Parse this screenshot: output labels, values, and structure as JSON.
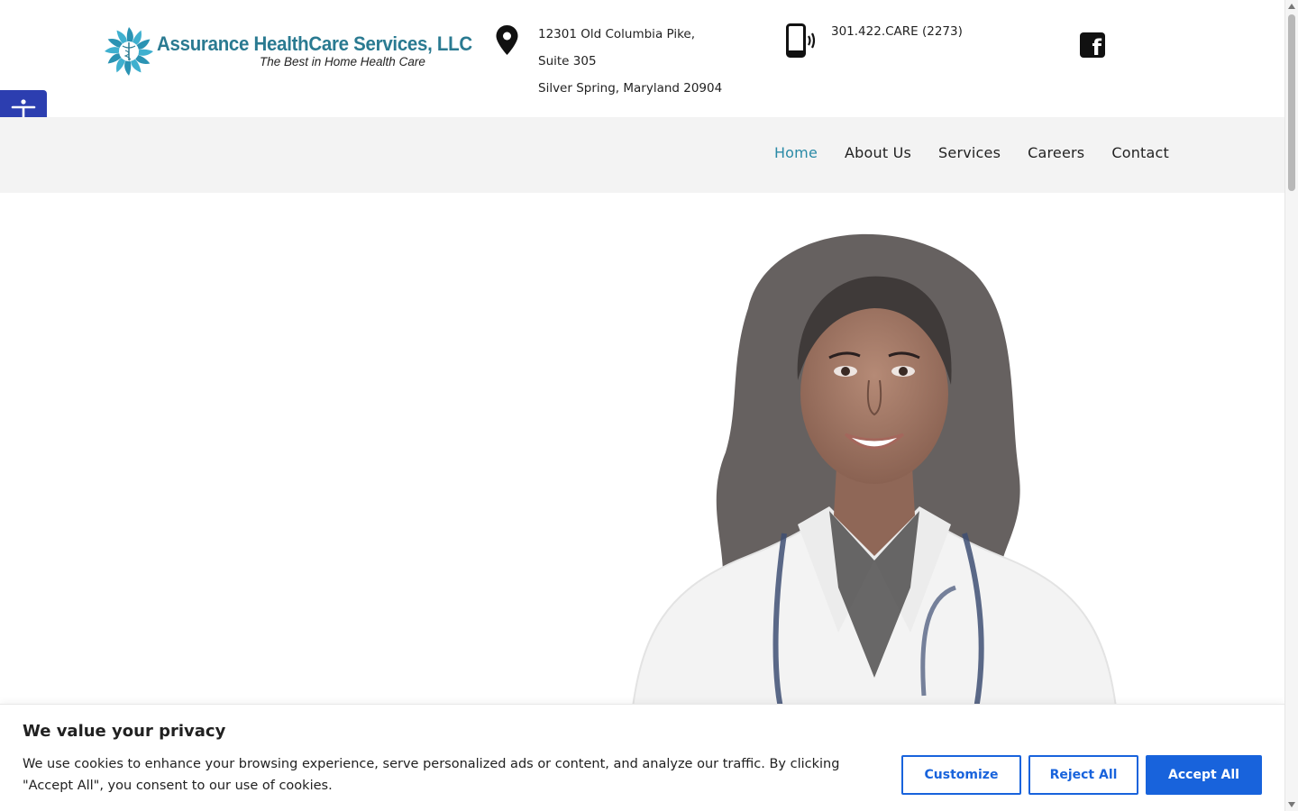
{
  "header": {
    "logo": {
      "name": "Assurance HealthCare Services, LLC",
      "tagline": "The Best in Home Health Care",
      "brand_color": "#2a7a91"
    },
    "address": {
      "icon": "map-marker-icon",
      "line1": "12301 Old Columbia Pike,",
      "line2": "Suite 305",
      "line3": "Silver Spring, Maryland 20904"
    },
    "phone": {
      "icon": "mobile-phone-icon",
      "number": "301.422.CARE (2273)"
    },
    "social": {
      "icon": "facebook-icon"
    },
    "accessibility": {
      "icon": "accessibility-icon",
      "color": "#2c3eb0"
    }
  },
  "nav": {
    "items": [
      {
        "label": "Home",
        "active": true
      },
      {
        "label": "About Us",
        "active": false
      },
      {
        "label": "Services",
        "active": false
      },
      {
        "label": "Careers",
        "active": false
      },
      {
        "label": "Contact",
        "active": false
      }
    ],
    "active_color": "#2a8aa6"
  },
  "hero": {
    "image": "doctor-portrait-image"
  },
  "cookie_banner": {
    "title": "We value your privacy",
    "text": "We use cookies to enhance your browsing experience, serve personalized ads or content, and analyze our traffic. By clicking \"Accept All\", you consent to our use of cookies.",
    "buttons": {
      "customize": "Customize",
      "reject": "Reject All",
      "accept": "Accept All"
    },
    "accent_color": "#1863dc"
  }
}
